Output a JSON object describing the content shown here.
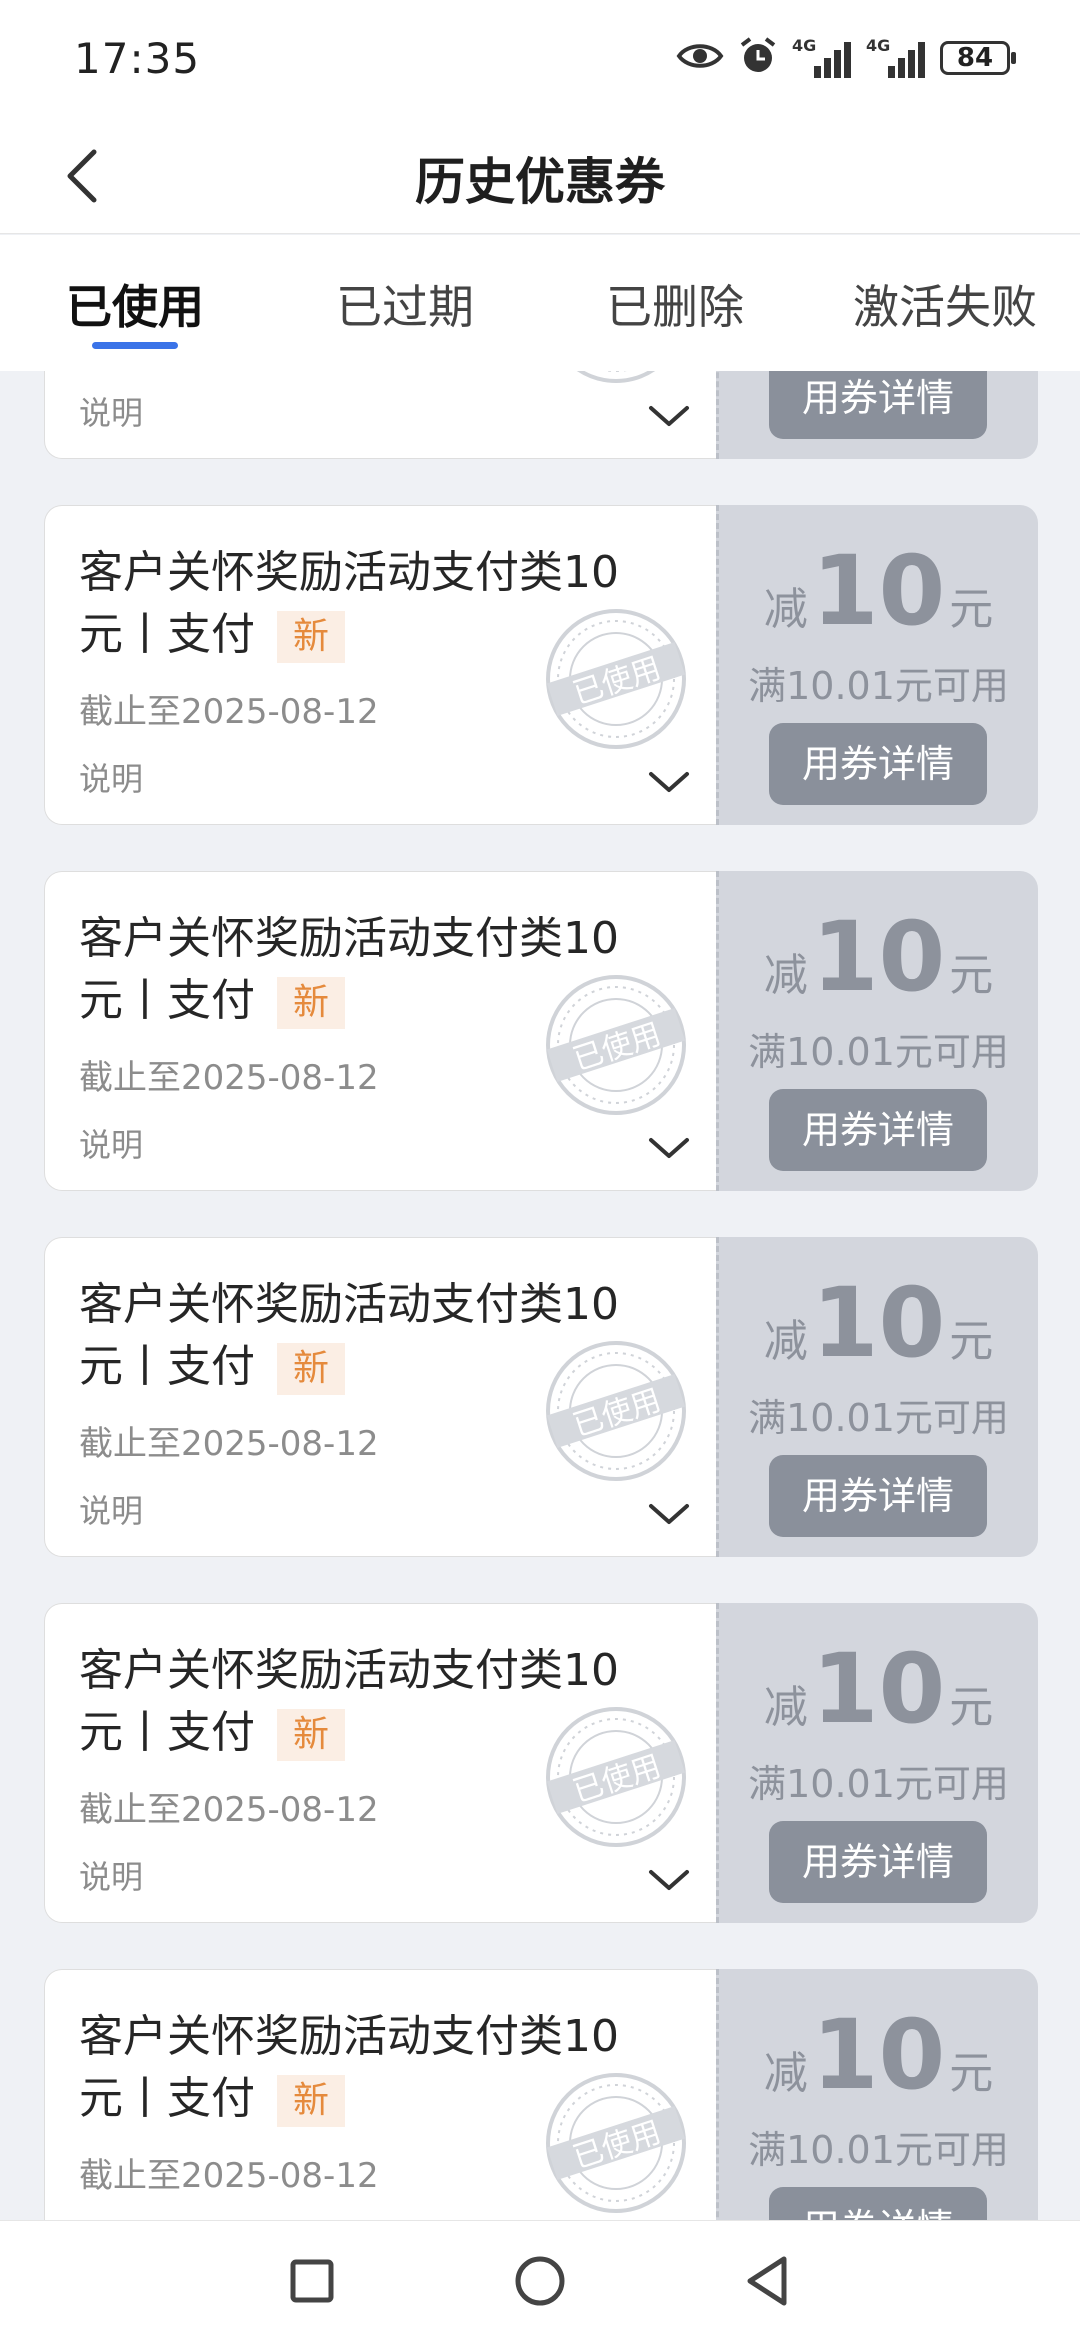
{
  "status_bar": {
    "time": "17:35",
    "battery": "84",
    "network_1": "4G",
    "network_2": "4G",
    "icons": [
      "eye-icon",
      "alarm-icon",
      "signal-icon",
      "signal-icon",
      "battery-icon"
    ]
  },
  "header": {
    "title": "历史优惠券",
    "back_icon": "chevron-left-icon"
  },
  "tabs": [
    {
      "label": "已使用",
      "active": true
    },
    {
      "label": "已过期",
      "active": false
    },
    {
      "label": "已删除",
      "active": false
    },
    {
      "label": "激活失败",
      "active": false
    }
  ],
  "coupon_template": {
    "title_line1": "客户关怀奖励活动支付类10",
    "title_line2": "元丨支付",
    "new_badge": "新",
    "expire": "截止至2025-08-12",
    "desc": "说明",
    "stamp_text": "已使用",
    "prefix": "减",
    "amount": "10",
    "unit": "元",
    "condition": "满10.01元可用",
    "detail_button": "用券详情"
  },
  "coupons": [
    {
      "title_line1": "客户关怀奖励活动支付类10",
      "title_line2": "元丨支付",
      "new_badge": "新",
      "expire": "截止至2025-08-12",
      "desc": "说明",
      "stamp_text": "已使用",
      "prefix": "减",
      "amount": "10",
      "unit": "元",
      "condition": "满10.01元可用",
      "detail_button": "用券详情"
    },
    {
      "title_line1": "客户关怀奖励活动支付类10",
      "title_line2": "元丨支付",
      "new_badge": "新",
      "expire": "截止至2025-08-12",
      "desc": "说明",
      "stamp_text": "已使用",
      "prefix": "减",
      "amount": "10",
      "unit": "元",
      "condition": "满10.01元可用",
      "detail_button": "用券详情"
    },
    {
      "title_line1": "客户关怀奖励活动支付类10",
      "title_line2": "元丨支付",
      "new_badge": "新",
      "expire": "截止至2025-08-12",
      "desc": "说明",
      "stamp_text": "已使用",
      "prefix": "减",
      "amount": "10",
      "unit": "元",
      "condition": "满10.01元可用",
      "detail_button": "用券详情"
    },
    {
      "title_line1": "客户关怀奖励活动支付类10",
      "title_line2": "元丨支付",
      "new_badge": "新",
      "expire": "截止至2025-08-12",
      "desc": "说明",
      "stamp_text": "已使用",
      "prefix": "减",
      "amount": "10",
      "unit": "元",
      "condition": "满10.01元可用",
      "detail_button": "用券详情"
    },
    {
      "title_line1": "客户关怀奖励活动支付类10",
      "title_line2": "元丨支付",
      "new_badge": "新",
      "expire": "截止至2025-08-12",
      "desc": "说明",
      "stamp_text": "已使用",
      "prefix": "减",
      "amount": "10",
      "unit": "元",
      "condition": "满10.01元可用",
      "detail_button": "用券详情"
    },
    {
      "title_line1": "客户关怀奖励活动支付类10",
      "title_line2": "元丨支付",
      "new_badge": "新",
      "expire": "截止至2025-08-12",
      "desc": "说明",
      "stamp_text": "已使用",
      "prefix": "减",
      "amount": "10",
      "unit": "元",
      "condition": "满10.01元可用",
      "detail_button": "用券详情"
    }
  ],
  "nav_bar": {
    "icons": [
      "recent-apps-icon",
      "home-icon",
      "back-icon"
    ]
  },
  "colors": {
    "accent": "#3a73e8",
    "badge_text": "#e58a3c",
    "badge_bg": "#fbeee4",
    "coupon_right_bg": "#d3d6dd",
    "button_bg": "#8a909b"
  }
}
